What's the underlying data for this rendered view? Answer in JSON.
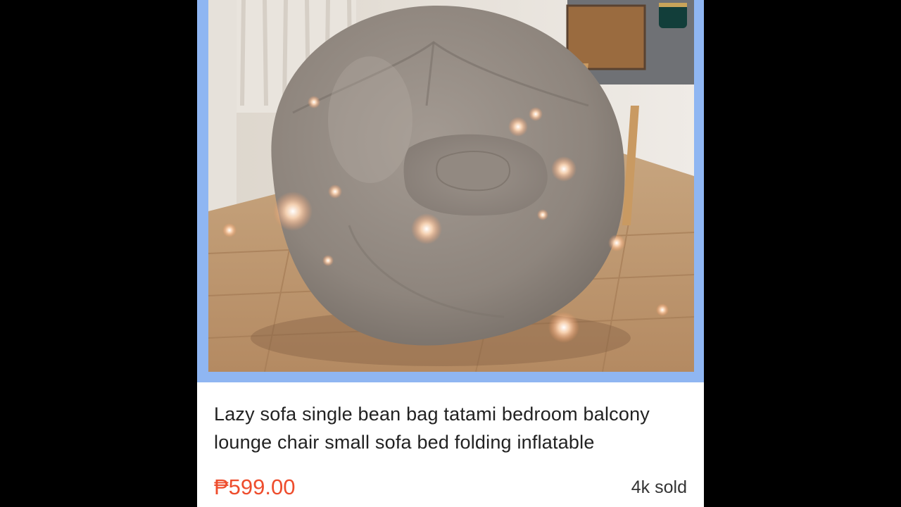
{
  "product": {
    "image_alt": "Grey inflatable bean bag sofa in a bedroom",
    "title": "Lazy sofa single bean bag tatami bedroom balcony lounge chair small sofa bed folding inflatable",
    "price": "₱599.00",
    "sold": "4k sold"
  },
  "colors": {
    "frame": "#8fb6f2",
    "price": "#ee4d2d",
    "title": "#222222"
  }
}
